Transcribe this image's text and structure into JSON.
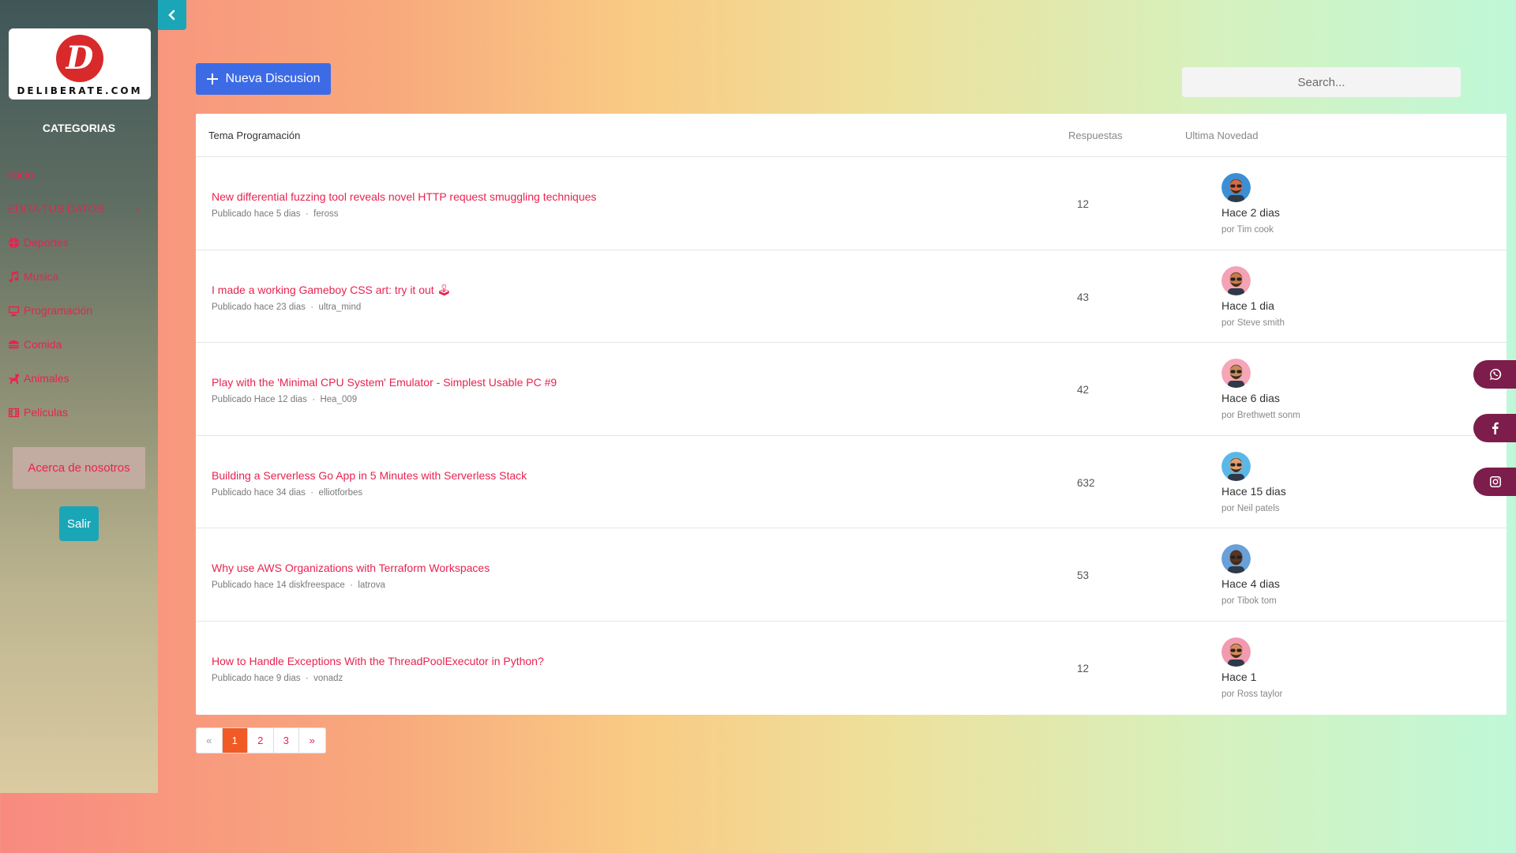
{
  "brand": {
    "logo_letter": "D",
    "logo_text": "DELIBERATE.COM"
  },
  "sidebar": {
    "title": "CATEGORIAS",
    "items": [
      {
        "label": "Inicio",
        "icon": "none"
      },
      {
        "label": "EDITA TUS DATOS",
        "icon": "none",
        "has_caret": true
      },
      {
        "label": "Deportes",
        "icon": "basketball-icon"
      },
      {
        "label": "Musica",
        "icon": "music-icon"
      },
      {
        "label": "Programación",
        "icon": "desktop-icon"
      },
      {
        "label": "Comida",
        "icon": "food-icon"
      },
      {
        "label": "Animales",
        "icon": "dog-icon"
      },
      {
        "label": "Peliculas",
        "icon": "film-icon"
      }
    ],
    "caret": "›",
    "about_label": "Acerca de nosotros",
    "logout_label": "Salir"
  },
  "toolbar": {
    "new_label": "Nueva Discusion",
    "search_placeholder": "Search..."
  },
  "table": {
    "headers": {
      "topic": "Tema Programación",
      "replies": "Respuestas",
      "latest": "Ultima Novedad"
    },
    "rows": [
      {
        "title": "New differential fuzzing tool reveals novel HTTP request smuggling techniques",
        "published": "Publicado hace 5 dias",
        "author": "feross",
        "replies": "12",
        "when": "Hace 2 dias",
        "by": "por Tim cook",
        "avatar_bg": "#3b8fd4",
        "avatar_skin": "#d96a45"
      },
      {
        "title": "I made a working Gameboy CSS art: try it out 🕹",
        "published": "Publicado hace 23 dias",
        "author": "ultra_mind",
        "replies": "43",
        "when": "Hace 1 dia",
        "by": "por Steve smith",
        "avatar_bg": "#f3a3b5",
        "avatar_skin": "#c97a4a"
      },
      {
        "title": "Play with the 'Minimal CPU System' Emulator - Simplest Usable PC #9",
        "published": "Publicado Hace 12 dias",
        "author": "Hea_009",
        "replies": "42",
        "when": "Hace 6 dias",
        "by": "por Brethwett sonm",
        "avatar_bg": "#f5a6b8",
        "avatar_skin": "#c98a5a"
      },
      {
        "title": "Building a Serverless Go App in 5 Minutes with Serverless Stack",
        "published": "Publicado hace 34 dias",
        "author": "elliotforbes",
        "replies": "632",
        "when": "Hace 15 dias",
        "by": "por Neil patels",
        "avatar_bg": "#5ab8e8",
        "avatar_skin": "#e0a070"
      },
      {
        "title": "Why use AWS Organizations with Terraform Workspaces",
        "published": "Publicado hace 14 diskfreespace",
        "author": "latrova",
        "replies": "53",
        "when": "Hace 4 dias",
        "by": "por Tibok tom",
        "avatar_bg": "#6aa0d8",
        "avatar_skin": "#5a3520"
      },
      {
        "title": "How to Handle Exceptions With the ThreadPoolExecutor in Python?",
        "published": "Publicado hace 9 dias",
        "author": "vonadz",
        "replies": "12",
        "when": "Hace 1",
        "by": "por Ross taylor",
        "avatar_bg": "#f19bb0",
        "avatar_skin": "#d98a5a"
      }
    ]
  },
  "pagination": {
    "prev": "«",
    "pages": [
      "1",
      "2",
      "3"
    ],
    "next": "»",
    "current": "1"
  },
  "social": [
    "whatsapp-icon",
    "facebook-icon",
    "instagram-icon"
  ],
  "colors": {
    "accent": "#e8234f",
    "primary": "#3d6be6",
    "teal": "#1ba6b7",
    "page_active": "#f15a24",
    "social": "#7d1d4b"
  }
}
